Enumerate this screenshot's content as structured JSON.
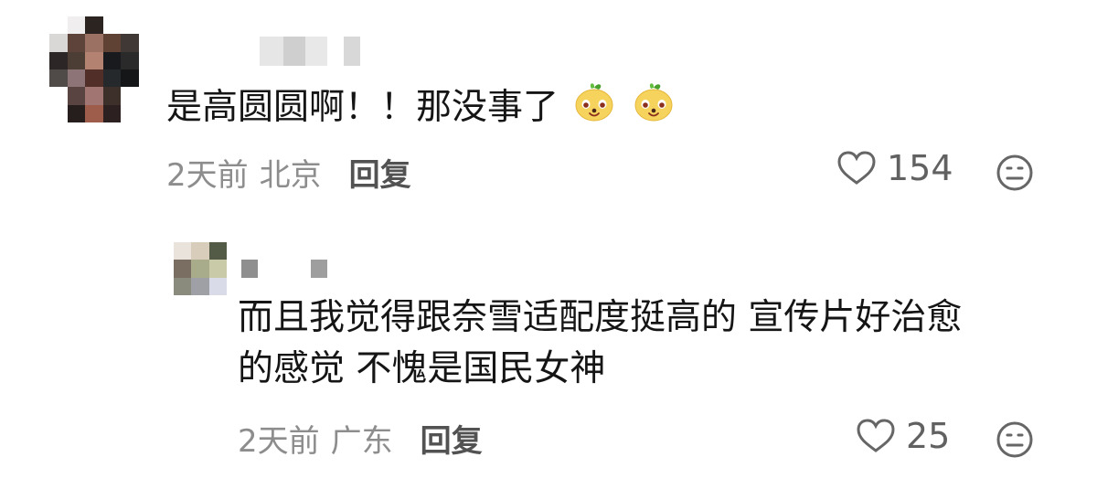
{
  "comments": [
    {
      "text": "是高圆圆啊！！那没事了",
      "time": "2天前",
      "location": "北京",
      "reply_label": "回复",
      "likes": "154",
      "icons": [
        "avatar",
        "emoji-icon",
        "heart-icon",
        "dislike-icon"
      ]
    },
    {
      "text_lines": [
        "而且我觉得跟奈雪适配度挺高的 宣传片好治愈",
        "的感觉 不愧是国民女神"
      ],
      "time": "2天前",
      "location": "广东",
      "reply_label": "回复",
      "likes": "25",
      "icons": [
        "avatar",
        "heart-icon",
        "dislike-icon"
      ]
    }
  ],
  "colors": {
    "text": "#151515",
    "meta": "#8d8d8d",
    "action": "#525252",
    "icon": "#666666",
    "emoji_yellow": "#f6d35d",
    "emoji_green": "#61b536"
  }
}
